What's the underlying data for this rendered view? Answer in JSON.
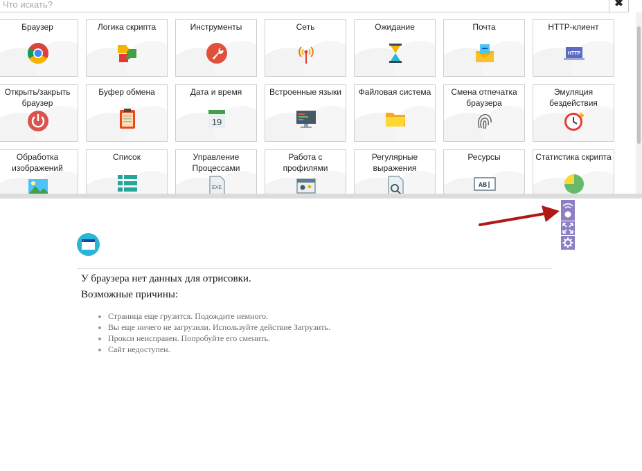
{
  "search": {
    "placeholder": "Что искать?",
    "clear_symbol": "✖"
  },
  "tiles": [
    {
      "label": "Браузер",
      "icon": "chrome-icon"
    },
    {
      "label": "Логика скрипта",
      "icon": "puzzle-icon"
    },
    {
      "label": "Инструменты",
      "icon": "wrench-icon"
    },
    {
      "label": "Сеть",
      "icon": "antenna-icon"
    },
    {
      "label": "Ожидание",
      "icon": "hourglass-icon"
    },
    {
      "label": "Почта",
      "icon": "mail-icon"
    },
    {
      "label": "HTTP-клиент",
      "icon": "http-laptop-icon",
      "badge": "HTTP"
    },
    {
      "label": "Открыть/закрыть браузер",
      "icon": "power-icon"
    },
    {
      "label": "Буфер обмена",
      "icon": "clipboard-icon"
    },
    {
      "label": "Дата и время",
      "icon": "calendar-icon",
      "badge": "19"
    },
    {
      "label": "Встроенные языки",
      "icon": "code-monitor-icon"
    },
    {
      "label": "Файловая система",
      "icon": "folder-icon"
    },
    {
      "label": "Смена отпечатка браузера",
      "icon": "fingerprint-icon"
    },
    {
      "label": "Эмуляция бездействия",
      "icon": "alarm-clock-icon"
    },
    {
      "label": "Обработка изображений",
      "icon": "image-icon"
    },
    {
      "label": "Список",
      "icon": "list-icon"
    },
    {
      "label": "Управление Процессами",
      "icon": "exe-file-icon",
      "badge": "EXE"
    },
    {
      "label": "Работа с профилями",
      "icon": "profile-icon"
    },
    {
      "label": "Регулярные выражения",
      "icon": "regex-file-icon"
    },
    {
      "label": "Ресурсы",
      "icon": "resource-ab-icon",
      "badge": "AB|"
    },
    {
      "label": "Статистика скрипта",
      "icon": "pie-chart-icon"
    }
  ],
  "browser": {
    "no_data_title": "У браузера нет данных для отрисовки.",
    "reasons_title": "Возможные причины:",
    "reasons": [
      "Страница еще грузится. Подождите немного.",
      "Вы еще ничего не загрузили. Используйте действие Загрузить.",
      "Прокси неисправен. Попробуйте его сменить.",
      "Сайт недоступен."
    ]
  },
  "side_tools": [
    {
      "icon": "signal-record-icon"
    },
    {
      "icon": "fit-screen-icon"
    },
    {
      "icon": "gear-icon"
    }
  ],
  "colors": {
    "side_button": "#8c7fc4",
    "arrow": "#b01818",
    "accent_cyan": "#29b6d6"
  }
}
